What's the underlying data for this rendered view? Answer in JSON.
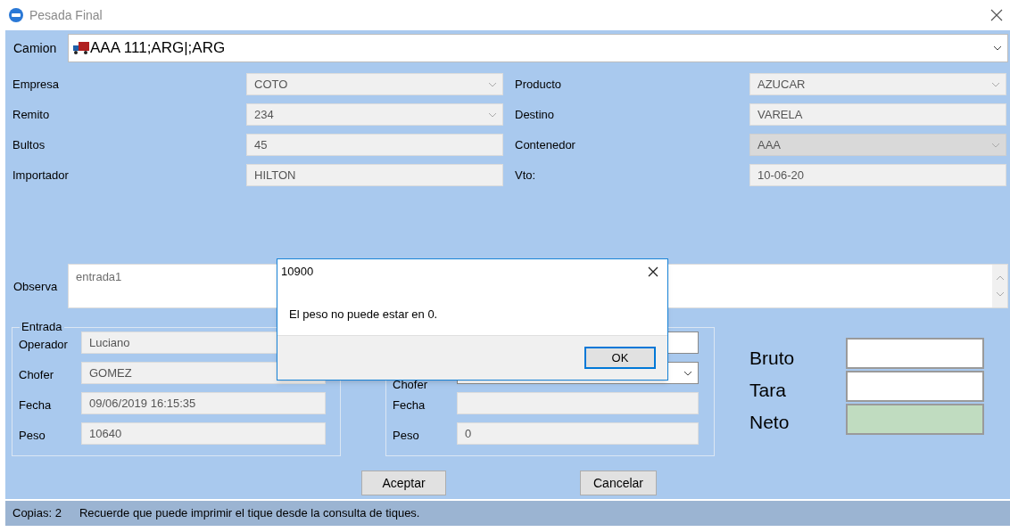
{
  "window": {
    "title": "Pesada Final"
  },
  "camion": {
    "label": "Camion",
    "value": "AAA 111;ARG|;ARG"
  },
  "fields_left": [
    {
      "label": "Empresa",
      "value": "COTO",
      "kind": "readonly_combo"
    },
    {
      "label": "Remito",
      "value": "234",
      "kind": "readonly_combo"
    },
    {
      "label": "Bultos",
      "value": "45",
      "kind": "readonly"
    },
    {
      "label": "Importador",
      "value": "HILTON",
      "kind": "readonly"
    }
  ],
  "fields_right": [
    {
      "label": "Producto",
      "value": "AZUCAR",
      "kind": "readonly_combo"
    },
    {
      "label": "Destino",
      "value": "VARELA",
      "kind": "readonly"
    },
    {
      "label": "Contenedor",
      "value": "AAA",
      "kind": "locked_combo"
    },
    {
      "label": "Vto:",
      "value": "10-06-20",
      "kind": "readonly"
    }
  ],
  "observa": {
    "label": "Observa",
    "value": "entrada1"
  },
  "entrada": {
    "title": "Entrada",
    "fields": [
      {
        "label": "Operador",
        "value": "Luciano",
        "kind": "readonly"
      },
      {
        "label": "Chofer",
        "value": "GOMEZ",
        "kind": "readonly"
      },
      {
        "label": "Fecha",
        "value": "09/06/2019 16:15:35",
        "kind": "readonly"
      },
      {
        "label": "Peso",
        "value": "10640",
        "kind": "readonly"
      }
    ]
  },
  "salida": {
    "fields": [
      {
        "kind": "input"
      },
      {
        "label": "Chofer",
        "kind": "combo"
      },
      {
        "label": "Fecha",
        "kind": "readonly"
      },
      {
        "label": "Peso",
        "value": "0",
        "kind": "readonly"
      }
    ]
  },
  "totals": [
    {
      "label": "Bruto",
      "kind": "input"
    },
    {
      "label": "Tara",
      "kind": "input"
    },
    {
      "label": "Neto",
      "kind": "result"
    }
  ],
  "buttons": [
    "Aceptar",
    "Cancelar"
  ],
  "status_bar": {
    "copies": "Copias: 2",
    "message": "Recuerde que puede imprimir el tique desde la consulta de tiques."
  },
  "dialog": {
    "title": "10900",
    "message": "El peso no puede estar en 0.",
    "button": "OK"
  }
}
